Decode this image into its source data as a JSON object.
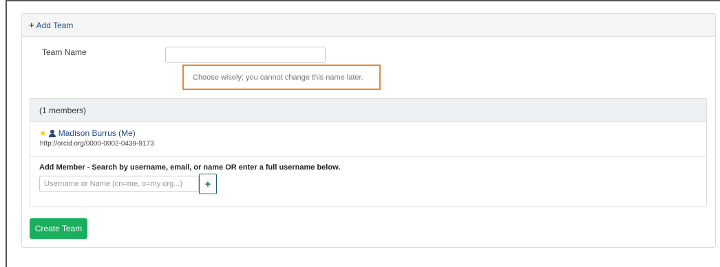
{
  "panel": {
    "heading_link": "Add Team",
    "plus_icon": "plus-icon"
  },
  "team_name": {
    "label": "Team Name",
    "value": "",
    "placeholder": "",
    "hint": "Choose wisely; you cannot change this name later."
  },
  "members": {
    "heading": "(1 members)",
    "list": [
      {
        "name": "Madison Burrus (Me)",
        "orcid": "http://orcid.org/0000-0002-0439-9173",
        "icons": [
          "star-icon",
          "person-icon"
        ]
      }
    ],
    "add_label": "Add Member - Search by username, email, or name OR enter a full username below.",
    "search_placeholder": "Username or Name (cn=me, o=my org...)",
    "add_button": "+"
  },
  "create_button": "Create Team",
  "colors": {
    "link": "#1d4e89",
    "create_button_bg": "#1aaf5d",
    "hint_border": "#e8873a",
    "star": "#f5c518"
  }
}
